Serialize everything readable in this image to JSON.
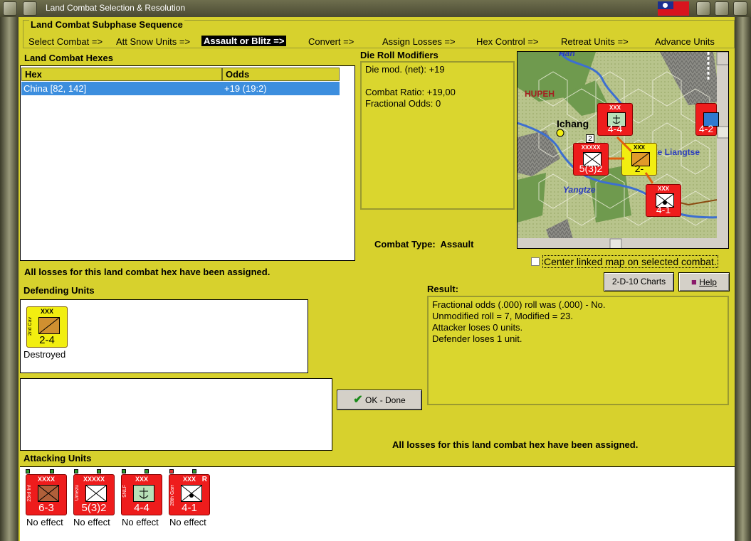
{
  "window": {
    "title": "Land Combat Selection & Resolution"
  },
  "subphase": {
    "title": "Land Combat Subphase Sequence",
    "steps": [
      "Select Combat =>",
      "Att Snow Units =>",
      "Assault or Blitz =>",
      "Convert =>",
      "Assign Losses =>",
      "Hex Control =>",
      "Retreat Units =>",
      "Advance Units"
    ],
    "active_step": "Assault or Blitz =>"
  },
  "hexes": {
    "label": "Land Combat Hexes",
    "columns": [
      "Hex",
      "Odds"
    ],
    "rows": [
      {
        "hex": "China [82, 142]",
        "odds": "+19 (19:2)"
      }
    ]
  },
  "modifiers": {
    "label": "Die Roll Modifiers",
    "lines": [
      "Die mod. (net): +19",
      "",
      "Combat Ratio: +19,00",
      "Fractional Odds: 0"
    ]
  },
  "combat_type": {
    "label": "Combat Type:",
    "value": "Assault"
  },
  "map": {
    "labels": {
      "hupeh": "HUPEH",
      "ichang": "Ichang",
      "yangtze": "Yangtze",
      "liangtse": "ke Liangtse",
      "han": "Han"
    },
    "counters": [
      {
        "str": "4-4",
        "size": "XXX"
      },
      {
        "str": "5(3)2",
        "size": "XXXXX"
      },
      {
        "str": "2-",
        "size": "XXX"
      },
      {
        "str": "4-1",
        "size": "XXX"
      },
      {
        "str": "4-2",
        "size": ""
      }
    ],
    "stack_count": "2"
  },
  "center_map": {
    "label": "Center linked map on selected combat."
  },
  "buttons": {
    "charts": "2-D-10 Charts",
    "help": "Help",
    "ok": "OK - Done"
  },
  "status_top": "All losses for this land combat hex have been assigned.",
  "status_bottom": "All losses for this land combat hex have been assigned.",
  "defending": {
    "label": "Defending Units",
    "units": [
      {
        "name": "2nd Cav",
        "size": "XXX",
        "str": "2-4",
        "status": "Destroyed",
        "color": "#f2ee10"
      }
    ]
  },
  "result": {
    "label": "Result:",
    "lines": [
      "Fractional odds (.000) roll was (.000)  - No.",
      "Unmodified roll = 7, Modified = 23.",
      "Attacker loses 0 units.",
      "Defender loses 1 unit."
    ]
  },
  "attacking": {
    "label": "Attacking Units",
    "units": [
      {
        "name": "23rd Inf",
        "size": "XXXX",
        "str": "6-3",
        "status": "No effect"
      },
      {
        "name": "Umezu",
        "size": "XXXXX",
        "str": "5(3)2",
        "status": "No effect"
      },
      {
        "name": "SNLF",
        "size": "XXX",
        "str": "4-4",
        "status": "No effect"
      },
      {
        "name": "28th Garr",
        "size": "XXX",
        "str": "4-1",
        "status": "No effect",
        "r": "R"
      }
    ]
  },
  "colors": {
    "panel": "#d7d12d",
    "selection": "#3c8ede",
    "counter_red": "#ee1c1c",
    "defender_yellow": "#f2ee10"
  }
}
